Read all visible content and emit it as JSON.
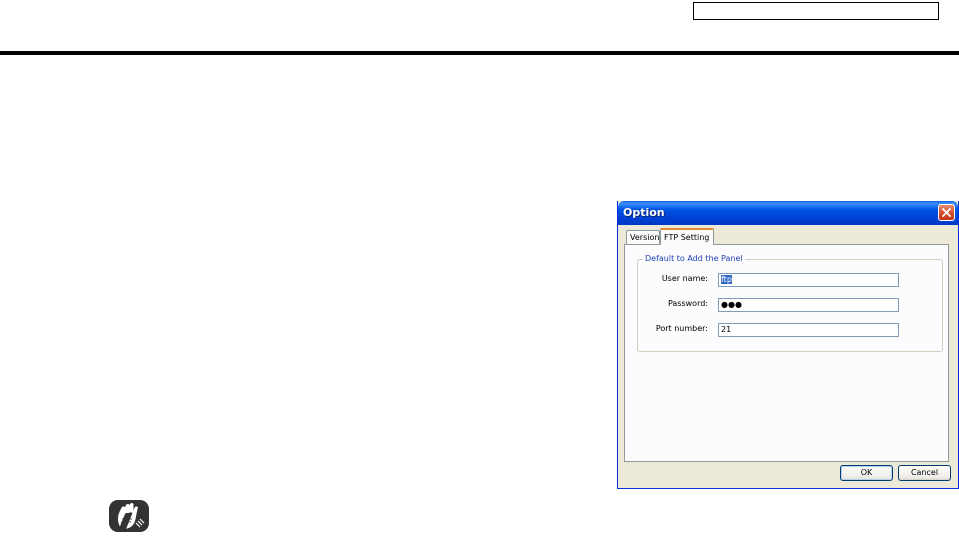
{
  "dialog": {
    "title": "Option",
    "tabs": [
      {
        "label": "Version",
        "active": false
      },
      {
        "label": "FTP Setting",
        "active": true
      }
    ],
    "group_title": "Default to Add the Panel",
    "fields": [
      {
        "label": "User name:",
        "value": "ftp",
        "selected": true
      },
      {
        "label": "Password:",
        "value": "●●●"
      },
      {
        "label": "Port number:",
        "value": "21"
      }
    ],
    "buttons": {
      "ok": "OK",
      "cancel": "Cancel"
    }
  },
  "icons": {
    "close": "close-icon",
    "hint": "hint-hand-icon"
  },
  "colors": {
    "titlebar": "#0055e5",
    "active_tab": "#e68b2c",
    "group_title": "#1c3fb5",
    "selection": "#316ac5"
  }
}
